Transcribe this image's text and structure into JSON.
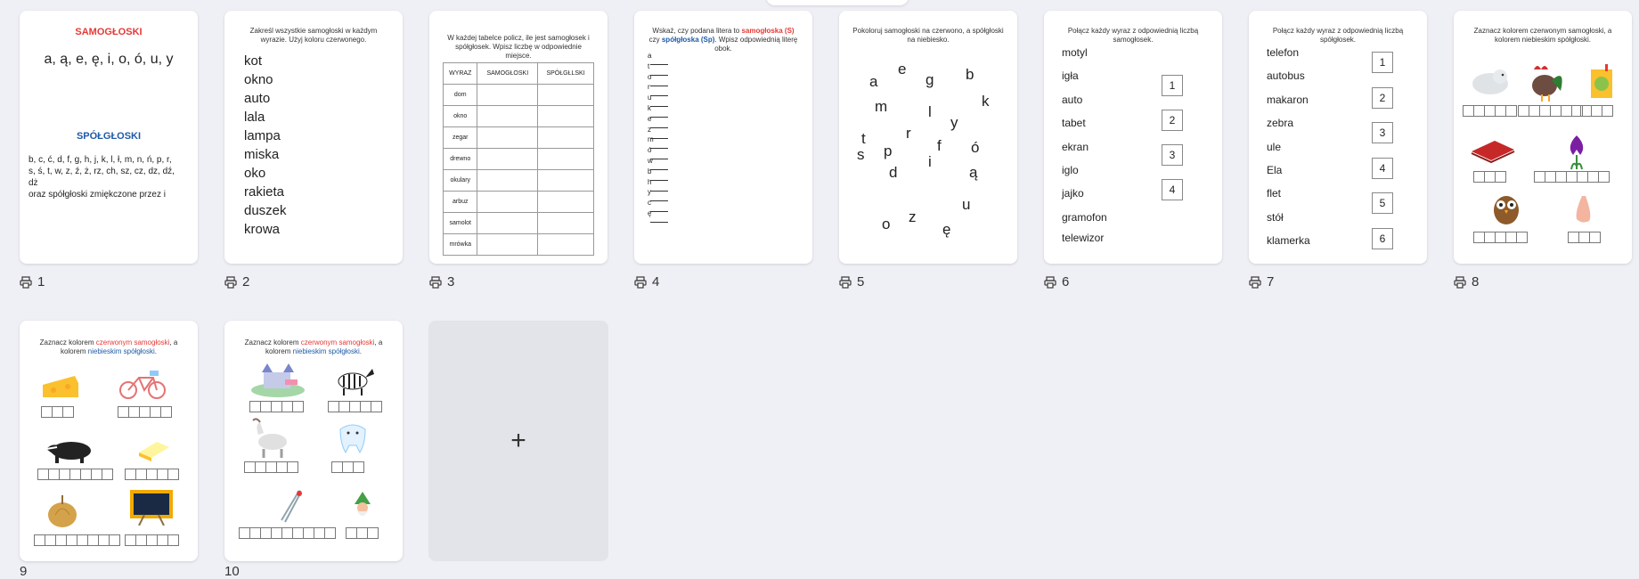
{
  "pages": [
    {
      "number": "1"
    },
    {
      "number": "2"
    },
    {
      "number": "3"
    },
    {
      "number": "4"
    },
    {
      "number": "5"
    },
    {
      "number": "6"
    },
    {
      "number": "7"
    },
    {
      "number": "8"
    },
    {
      "number": "9"
    },
    {
      "number": "10"
    }
  ],
  "add_label": "+",
  "p1": {
    "heading_vowels": "SAMOGŁOSKI",
    "vowels": "a, ą, e, ę, i, o, ó, u, y",
    "heading_consonants": "SPÓŁGŁOSKI",
    "consonants_1": "b, c, ć, d, f, g, h, j, k, l, ł, m, n, ń, p, r,",
    "consonants_2": "s, ś, t, w, z, ź, ż, rz, ch, sz, cz, dz, dź,",
    "consonants_3": "dż",
    "consonants_4": "oraz spółgłoski zmiękczone przez i"
  },
  "p2": {
    "instruction": "Zakreśl wszystkie samogłoski w każdym wyrazie. Użyj koloru czerwonego.",
    "words": [
      "kot",
      "okno",
      "auto",
      "lala",
      "lampa",
      "miska",
      "oko",
      "rakieta",
      "duszek",
      "krowa"
    ]
  },
  "p3": {
    "instruction": "W każdej tabelce policz, ile jest samogłosek i spółgłosek. Wpisz liczbę w odpowiednie miejsce.",
    "headers": [
      "WYRAZ",
      "SAMOGŁOSKI",
      "SPÓŁGŁLSKI"
    ],
    "words": [
      "dom",
      "okno",
      "zegar",
      "drewno",
      "okulary",
      "arbuz",
      "samolot",
      "mrówka"
    ]
  },
  "p4": {
    "instr_1": "Wskaż, czy podana litera to ",
    "instr_red": "samogłoska (S)",
    "instr_2": " czy ",
    "instr_blue": "spółgłoska (Sp)",
    "instr_3": ". Wpisz odpowiednią literę obok.",
    "letters": [
      "a",
      "t",
      "o",
      "r",
      "u",
      "k",
      "e",
      "z",
      "m",
      "ó",
      "w",
      "b",
      "h",
      "y",
      "c",
      "ę"
    ]
  },
  "p5": {
    "instruction": "Pokoloruj samogłoski na czerwono, a spółgłoski na niebiesko.",
    "letters": [
      "a",
      "e",
      "g",
      "b",
      "m",
      "l",
      "k",
      "y",
      "r",
      "t",
      "ó",
      "p",
      "f",
      "s",
      "d",
      "i",
      "ą",
      "u",
      "z",
      "o",
      "ę"
    ]
  },
  "p6": {
    "instruction": "Połącz każdy wyraz z odpowiednią liczbą samogłosek.",
    "words": [
      "motyl",
      "igła",
      "auto",
      "tabet",
      "ekran",
      "iglo",
      "jajko",
      "gramofon",
      "telewizor"
    ],
    "numbers": [
      "1",
      "2",
      "3",
      "4"
    ]
  },
  "p7": {
    "instruction": "Połącz każdy wyraz z odpowiednią liczbą spółgłosek.",
    "words": [
      "telefon",
      "autobus",
      "makaron",
      "zebra",
      "ule",
      "Ela",
      "flet",
      "stół",
      "klamerka"
    ],
    "numbers": [
      "1",
      "2",
      "3",
      "4",
      "5",
      "6"
    ]
  },
  "p8": {
    "instr_1": "Zaznacz kolorem czerwonym samogłoski, a kolorem niebieskim spółgłoski."
  },
  "p9": {
    "instr_1": "Zaznacz kolorem ",
    "instr_red": "czerwonym samogłoski",
    "instr_2": ", a kolorem ",
    "instr_blue": "niebieskim spółgłoski",
    "instr_3": "."
  },
  "p10": {
    "instr_1": "Zaznacz kolorem ",
    "instr_red": "czerwonym samogłoski",
    "instr_2": ", a kolorem ",
    "instr_blue": "niebieskim spółgłoski",
    "instr_3": "."
  },
  "colors": {
    "vowel_red": "#e53935",
    "consonant_blue": "#1e5aa8",
    "bg": "#eff0f5"
  }
}
